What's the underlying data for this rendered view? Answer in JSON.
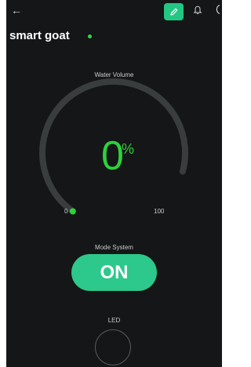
{
  "header": {
    "back_icon": "arrow-left-icon",
    "edit_icon": "pencil-icon",
    "bell_icon": "bell-icon",
    "more_icon": "more-icon",
    "accent_color": "#23c784"
  },
  "device": {
    "name": "smart goat",
    "status_color": "#35d646"
  },
  "gauge": {
    "label": "Water Volume",
    "value": "0",
    "unit": "%",
    "min": "0",
    "max": "100",
    "value_color": "#2ed03c",
    "level_fraction": 0
  },
  "mode": {
    "label": "Mode System",
    "button_text": "ON",
    "button_color": "#2dc88b"
  },
  "led": {
    "label": "LED"
  }
}
